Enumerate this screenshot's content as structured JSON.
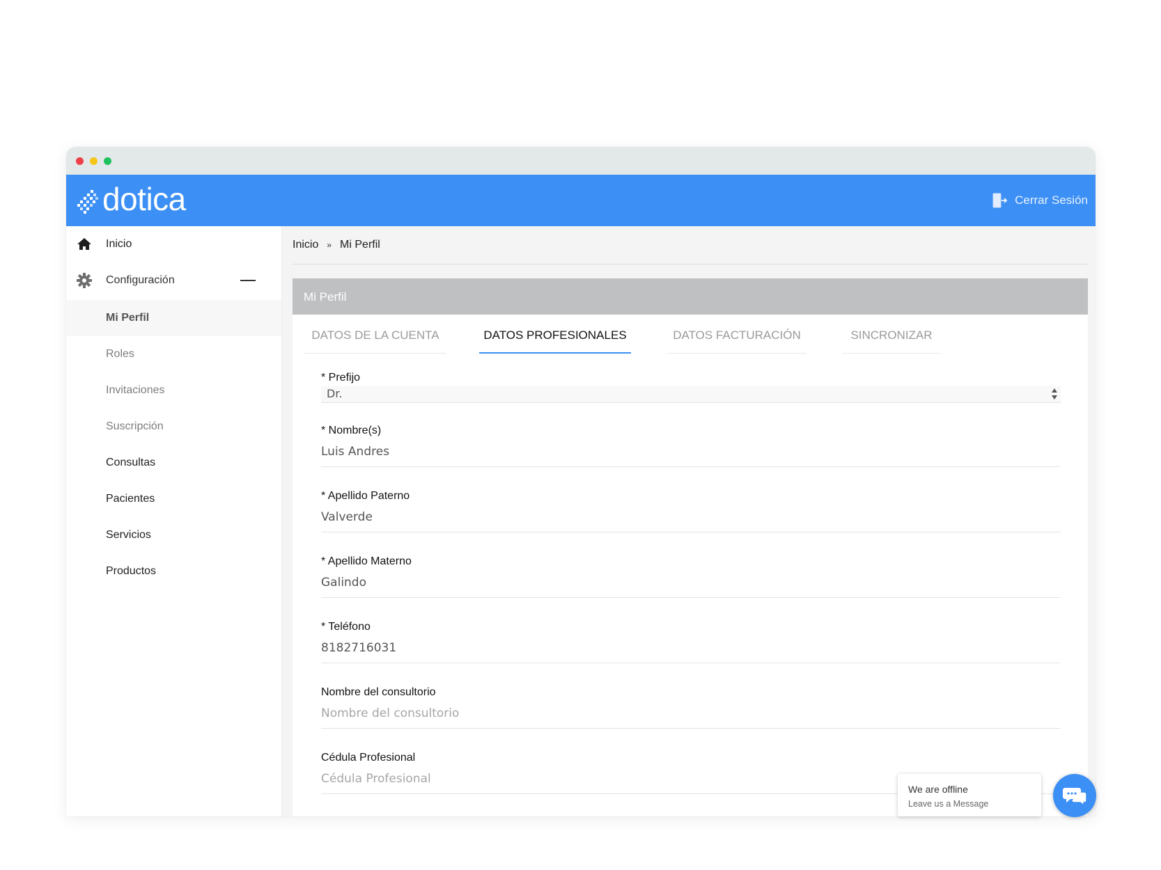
{
  "app": {
    "logo_text": "dotica"
  },
  "colors": {
    "brand_blue": "#3b8ff5",
    "header_gray": "#bfc0c2",
    "dot_red": "#ef4048",
    "dot_yellow": "#f5c518",
    "dot_green": "#1fc15e"
  },
  "header": {
    "logout_label": "Cerrar Sesión",
    "logout_icon": "logout-door-icon"
  },
  "sidebar": {
    "items": [
      {
        "label": "Inicio",
        "icon": "home-icon"
      },
      {
        "label": "Configuración",
        "icon": "gear-icon"
      },
      {
        "label": "Mi Perfil"
      },
      {
        "label": "Roles"
      },
      {
        "label": "Invitaciones"
      },
      {
        "label": "Suscripción"
      },
      {
        "label": "Consultas"
      },
      {
        "label": "Pacientes"
      },
      {
        "label": "Servicios"
      },
      {
        "label": "Productos"
      }
    ]
  },
  "breadcrumb": {
    "home": "Inicio",
    "separator": "»",
    "current": "Mi Perfil"
  },
  "card": {
    "title": "Mi Perfil",
    "tabs": [
      {
        "label": "DATOS DE LA CUENTA"
      },
      {
        "label": "DATOS PROFESIONALES"
      },
      {
        "label": "DATOS FACTURACIÓN"
      },
      {
        "label": "SINCRONIZAR"
      }
    ],
    "active_tab": "DATOS PROFESIONALES"
  },
  "form": {
    "prefijo": {
      "label": "* Prefijo",
      "value": "Dr."
    },
    "nombre": {
      "label": "* Nombre(s)",
      "value": "Luis Andres"
    },
    "apellido_paterno": {
      "label": "* Apellido Paterno",
      "value": "Valverde"
    },
    "apellido_materno": {
      "label": "* Apellido Materno",
      "value": "Galindo"
    },
    "telefono": {
      "label": "* Teléfono",
      "value": "8182716031"
    },
    "consultorio": {
      "label": "Nombre del consultorio",
      "placeholder": "Nombre del consultorio"
    },
    "cedula": {
      "label": "Cédula Profesional",
      "placeholder": "Cédula Profesional"
    }
  },
  "chat": {
    "title": "We are offline",
    "subtitle": "Leave us a Message"
  }
}
